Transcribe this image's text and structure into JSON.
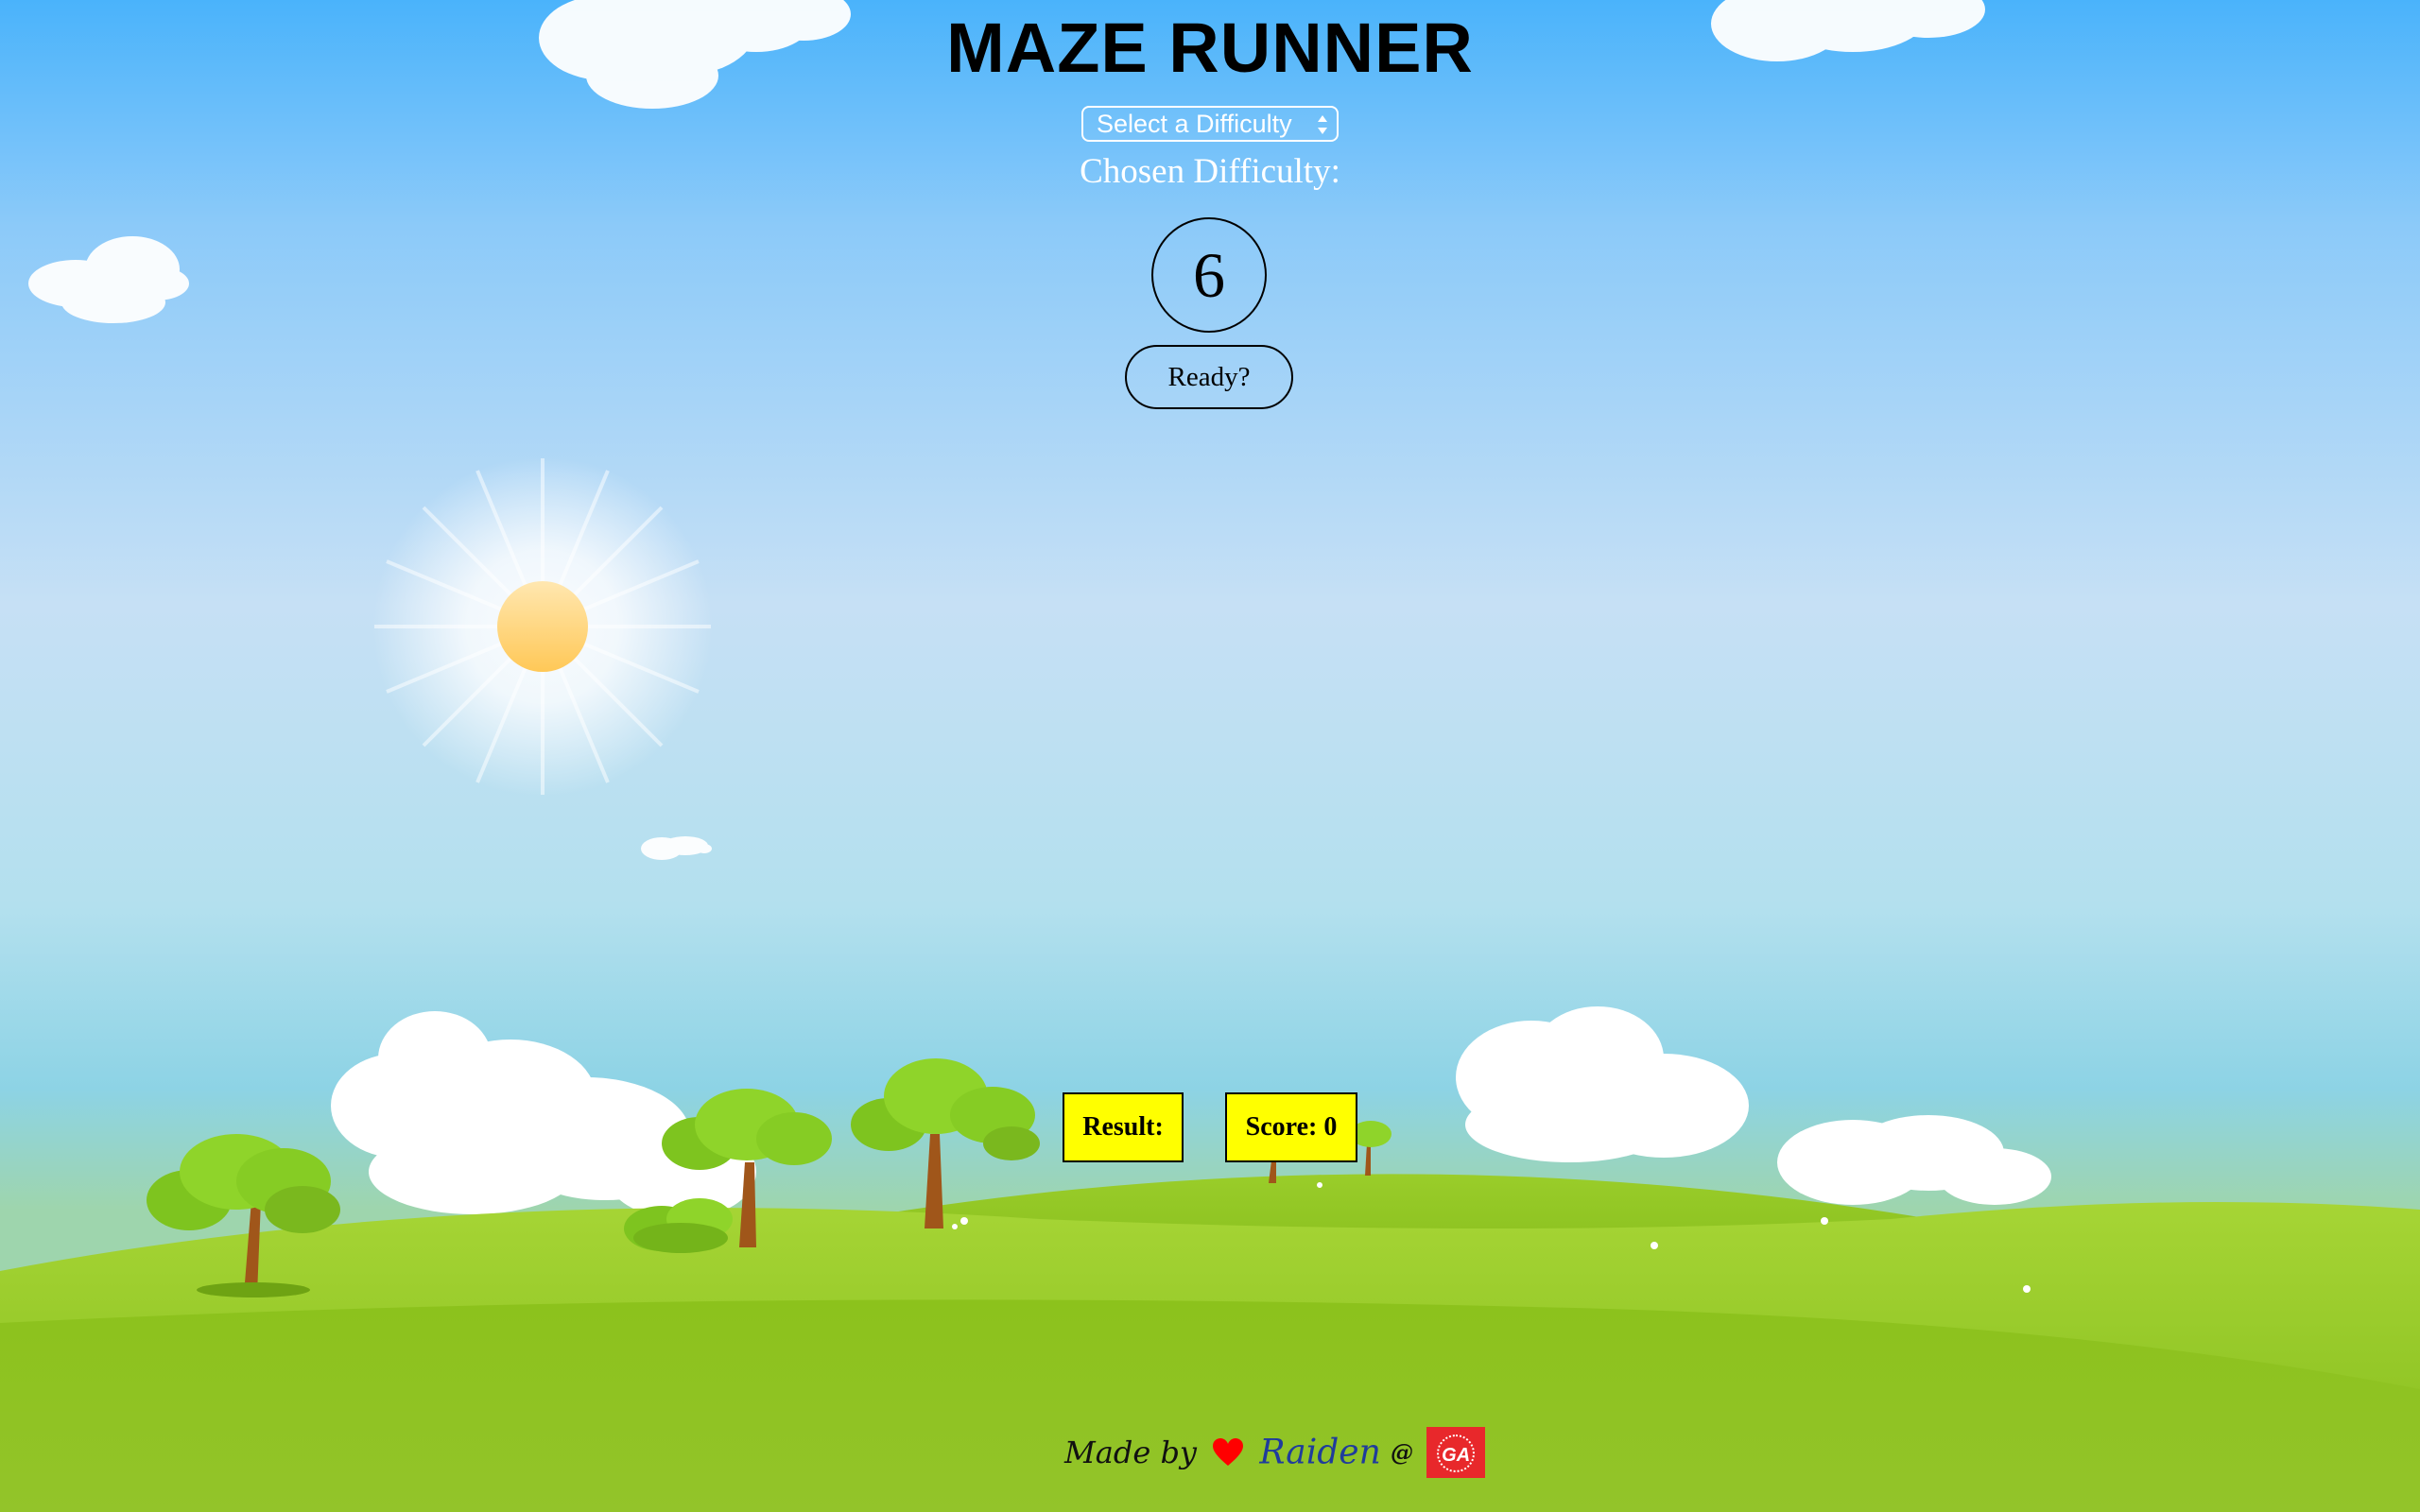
{
  "game": {
    "title": "MAZE RUNNER",
    "difficulty_select": {
      "selected": "Select a Difficulty"
    },
    "chosen_difficulty_label": "Chosen Difficulty:",
    "difficulty_value": "6",
    "ready_button": "Ready?",
    "result_label": "Result:",
    "score_label": "Score: 0"
  },
  "footer": {
    "made_by": "Made by",
    "author": "Raiden",
    "at": "@",
    "org_logo": "GA"
  },
  "colors": {
    "sky_top": "#4ab3fb",
    "grass": "#8cc21c",
    "status_box": "#ffff00",
    "heart": "#ff0000",
    "author_link": "#1f3c9c",
    "ga_logo": "#e8282b"
  },
  "icons": [
    "sun-icon",
    "heart-icon",
    "ga-logo-icon",
    "select-arrows-icon"
  ]
}
